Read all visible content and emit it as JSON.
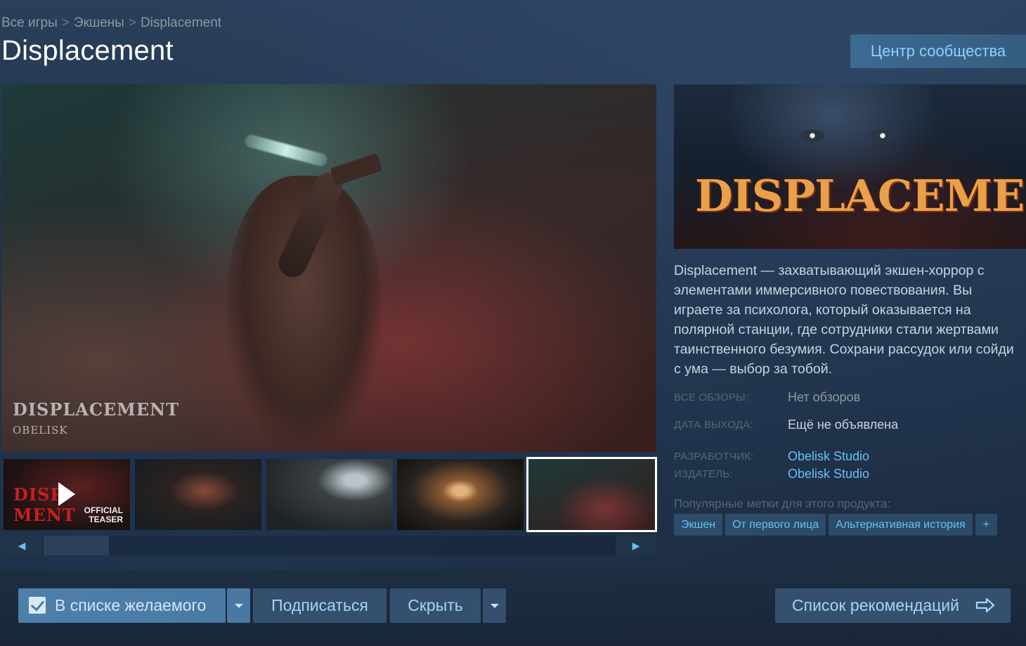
{
  "breadcrumb": {
    "items": [
      "Все игры",
      "Экшены",
      "Displacement"
    ],
    "separator": ">"
  },
  "title": "Displacement",
  "community_button": "Центр сообщества",
  "main_media": {
    "watermark_title": "DISPLACEMENT",
    "watermark_sub": "OBELISK"
  },
  "thumbs": {
    "first_title": "DISP  MENT",
    "first_label": "OFFICIAL\nTEASER"
  },
  "capsule": {
    "logo_text": "DISPLACEMENT"
  },
  "description": "Displacement — захватывающий экшен-хоррор с элементами иммерсивного повествования. Вы играете за психолога, который оказывается на полярной станции, где сотрудники стали жертвами таинственного безумия. Сохрани рассудок или сойди с ума — выбор за тобой.",
  "info": {
    "reviews_label": "ВСЕ ОБЗОРЫ:",
    "reviews_value": "Нет обзоров",
    "release_label": "ДАТА ВЫХОДА:",
    "release_value": "Ещё не объявлена",
    "developer_label": "РАЗРАБОТЧИК:",
    "developer_value": "Obelisk Studio",
    "publisher_label": "ИЗДАТЕЛЬ:",
    "publisher_value": "Obelisk Studio"
  },
  "tags": {
    "label": "Популярные метки для этого продукта:",
    "items": [
      "Экшен",
      "От первого лица",
      "Альтернативная история"
    ],
    "more": "+"
  },
  "actions": {
    "wishlist": "В списке желаемого",
    "follow": "Подписаться",
    "ignore": "Скрыть",
    "queue": "Список рекомендаций"
  },
  "colors": {
    "link": "#66c0f4",
    "background": "#1b2838",
    "accent_button": "#4e7faa"
  }
}
